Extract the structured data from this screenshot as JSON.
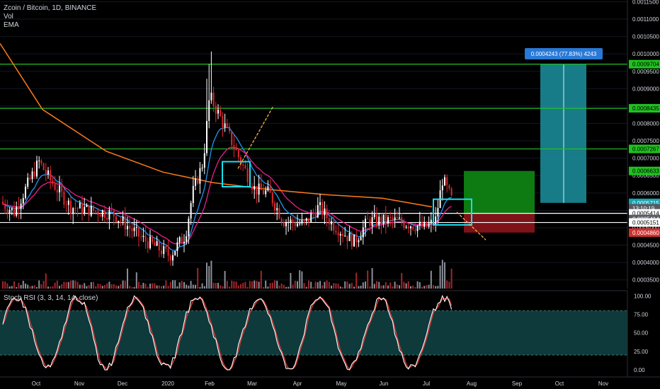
{
  "legend": {
    "title": "Zcoin / Bitcoin, 1D, BINANCE",
    "vol": "Vol",
    "ema": "EMA"
  },
  "rsi_legend": "Stoch RSI (3, 3, 14, 14, close)",
  "colors": {
    "bg": "#000000",
    "grid": "#131722",
    "candle_up": "#ffffff",
    "candle_down": "#e0282e",
    "ema_short": "#2196f3",
    "ema_mid": "#e91e8c",
    "ema_long": "#ff7a1a",
    "hline_green": "#22c22a",
    "hline_white": "#ffffff",
    "highlight": "#18e0f0",
    "arrow": "#ffb13b",
    "target_box": "#1a8a96",
    "stop_box": "#7d1318",
    "profit_box": "#0d7a12",
    "rsi_fill": "#0e3a3c",
    "rsi_k": "#ffffff",
    "rsi_d": "#e53935"
  },
  "price_axis": {
    "ticks": [
      "0.0011500",
      "0.0011000",
      "0.0010500",
      "0.0010000",
      "0.0009500",
      "0.0009000",
      "0.0008500",
      "0.0008000",
      "0.0007500",
      "0.0007000",
      "0.0006500",
      "0.0006000",
      "0.0005500",
      "0.0005000",
      "0.0004500",
      "0.0004000",
      "0.0003500"
    ],
    "labels": [
      {
        "text": "0.0009704",
        "kind": "green",
        "value": 0.0009704
      },
      {
        "text": "0.0008435",
        "kind": "green",
        "value": 0.0008435
      },
      {
        "text": "0.0007267",
        "kind": "green",
        "value": 0.0007267
      },
      {
        "text": "0.0006633",
        "kind": "green",
        "value": 0.0006633
      },
      {
        "text": "0.0005715",
        "kind": "cyan",
        "value": 0.0005715
      },
      {
        "text": "13:10:19",
        "kind": "gray",
        "value": 0.000556
      },
      {
        "text": "0.0005414",
        "kind": "white",
        "value": 0.0005414
      },
      {
        "text": "0.0005414",
        "kind": "gray",
        "value": 0.000525
      },
      {
        "text": "0.0005151",
        "kind": "white",
        "value": 0.0005151
      },
      {
        "text": "0.0004860",
        "kind": "red",
        "value": 0.000486
      }
    ]
  },
  "rsi_axis": {
    "ticks": [
      "100.00",
      "75.00",
      "50.00",
      "25.00",
      "0.00"
    ]
  },
  "time_axis": {
    "labels": [
      "Oct",
      "Nov",
      "Dec",
      "2020",
      "Feb",
      "Mar",
      "Apr",
      "May",
      "Jun",
      "Jul",
      "Aug",
      "Sep",
      "Oct",
      "Nov"
    ]
  },
  "measure": {
    "label": "0.0004243 (77.83%) 4243"
  },
  "chart_data": {
    "type": "candlestick",
    "symbol": "Zcoin / Bitcoin",
    "interval": "1D",
    "exchange": "BINANCE",
    "y_range": [
      0.000325,
      0.00116
    ],
    "horizontal_levels": [
      {
        "value": 0.0009704,
        "color": "green"
      },
      {
        "value": 0.0008435,
        "color": "green"
      },
      {
        "value": 0.0007267,
        "color": "green"
      },
      {
        "value": 0.0005414,
        "color": "white"
      },
      {
        "value": 0.0005151,
        "color": "white"
      }
    ],
    "position_long": {
      "entry": 0.0005715,
      "target": 0.0009704,
      "change": "0.0004243 (77.83%)"
    },
    "position_small": {
      "entry": 0.0005414,
      "target": 0.0006633,
      "stop": 0.000486
    },
    "stoch_rsi": {
      "range": [
        0,
        100
      ],
      "band": [
        20,
        80
      ]
    }
  }
}
